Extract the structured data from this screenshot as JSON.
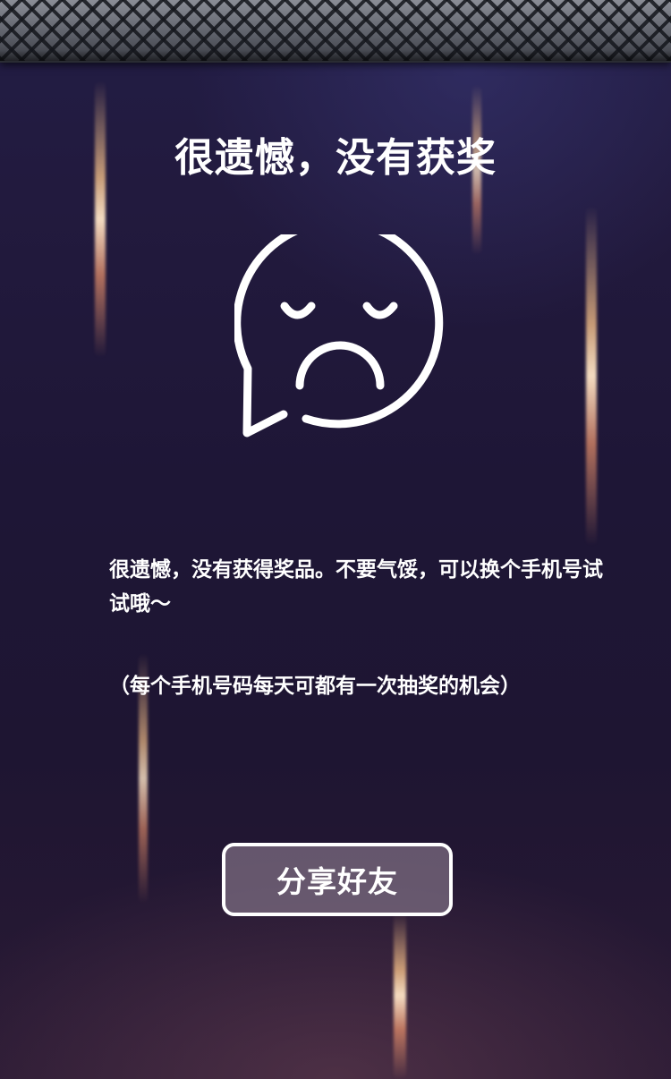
{
  "result": {
    "title": "很遗憾，没有获奖",
    "icon": "sad-face-speech-bubble-icon",
    "message": "很遗憾，没有获得奖品。不要气馁，可以换个手机号试试哦～",
    "note": "（每个手机号码每天可都有一次抽奖的机会）"
  },
  "actions": {
    "share_label": "分享好友"
  },
  "colors": {
    "text": "#ffffff",
    "background": "#1e1636",
    "button_fill": "#78697d"
  }
}
